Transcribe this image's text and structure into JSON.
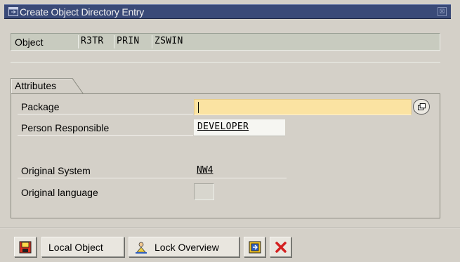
{
  "window": {
    "title": "Create Object Directory Entry",
    "close_symbol": "⊠"
  },
  "object": {
    "label": "Object",
    "pgmid": "R3TR",
    "type": "PRIN",
    "name": "ZSWIN"
  },
  "attributes": {
    "tab_label": "Attributes",
    "package": {
      "label": "Package",
      "value": "",
      "f4_icon": "value-help-icon"
    },
    "person_responsible": {
      "label": "Person Responsible",
      "value": "DEVELOPER"
    },
    "original_system": {
      "label": "Original System",
      "value": "NW4"
    },
    "original_language": {
      "label": "Original language",
      "value": ""
    }
  },
  "toolbar": {
    "save_icon": "save-icon",
    "local_object_label": "Local Object",
    "lock_overview_label": "Lock Overview",
    "lock_overview_icon": "people-icon",
    "transport_icon": "transport-icon",
    "cancel_icon": "cancel-icon"
  },
  "colors": {
    "title_bar": "#3a4a78",
    "required_field": "#fbe3a2",
    "dialog_bg": "#d4d0c8",
    "cancel_red": "#d42020"
  }
}
